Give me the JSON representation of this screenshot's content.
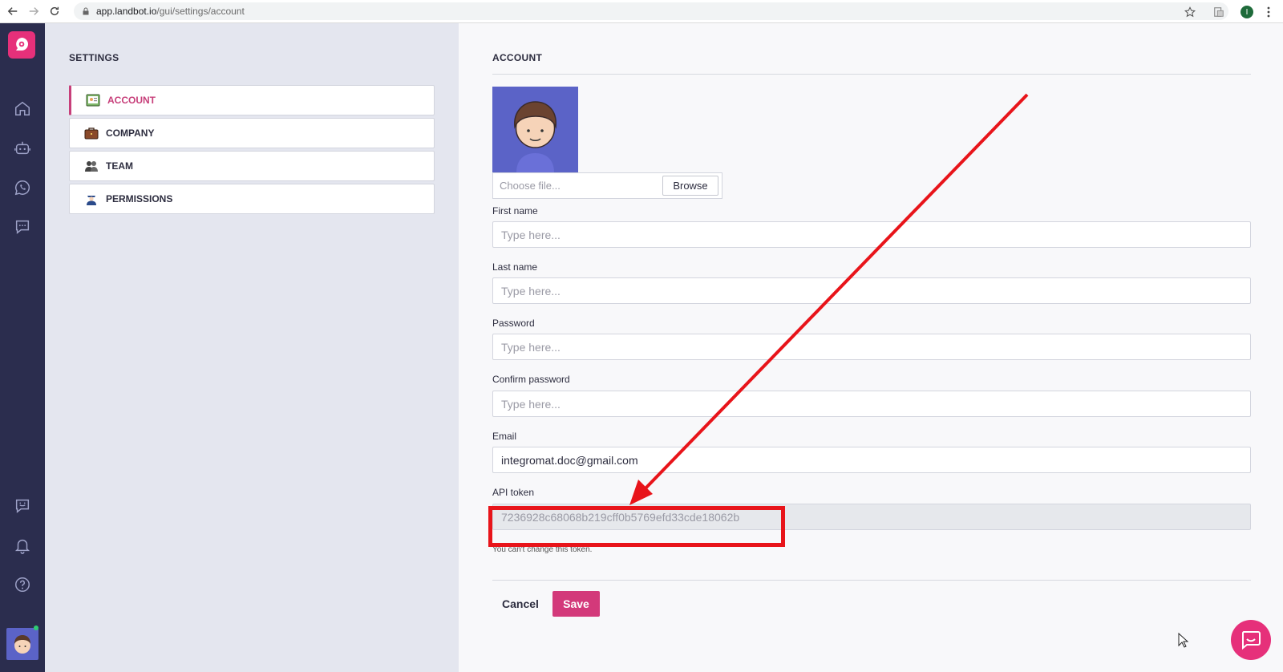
{
  "browser": {
    "url_host": "app.landbot.io",
    "url_path": "/gui/settings/account",
    "profile_initial": "I"
  },
  "settings": {
    "title": "SETTINGS",
    "menu": [
      {
        "label": "ACCOUNT",
        "icon": "id-card-icon",
        "active": true
      },
      {
        "label": "COMPANY",
        "icon": "briefcase-icon",
        "active": false
      },
      {
        "label": "TEAM",
        "icon": "team-icon",
        "active": false
      },
      {
        "label": "PERMISSIONS",
        "icon": "guard-icon",
        "active": false
      }
    ]
  },
  "account": {
    "title": "ACCOUNT",
    "file_placeholder": "Choose file...",
    "browse_label": "Browse",
    "first_name": {
      "label": "First name",
      "placeholder": "Type here..."
    },
    "last_name": {
      "label": "Last name",
      "placeholder": "Type here..."
    },
    "password": {
      "label": "Password",
      "placeholder": "Type here..."
    },
    "confirm_password": {
      "label": "Confirm password",
      "placeholder": "Type here..."
    },
    "email": {
      "label": "Email",
      "value": "integromat.doc@gmail.com"
    },
    "api_token": {
      "label": "API token",
      "value": "7236928c68068b219cff0b5769efd33cde18062b",
      "help": "You can't change this token."
    },
    "cancel_label": "Cancel",
    "save_label": "Save"
  },
  "colors": {
    "accent": "#d3397a",
    "rail": "#2b2d4e",
    "annotation": "#e8141a"
  }
}
